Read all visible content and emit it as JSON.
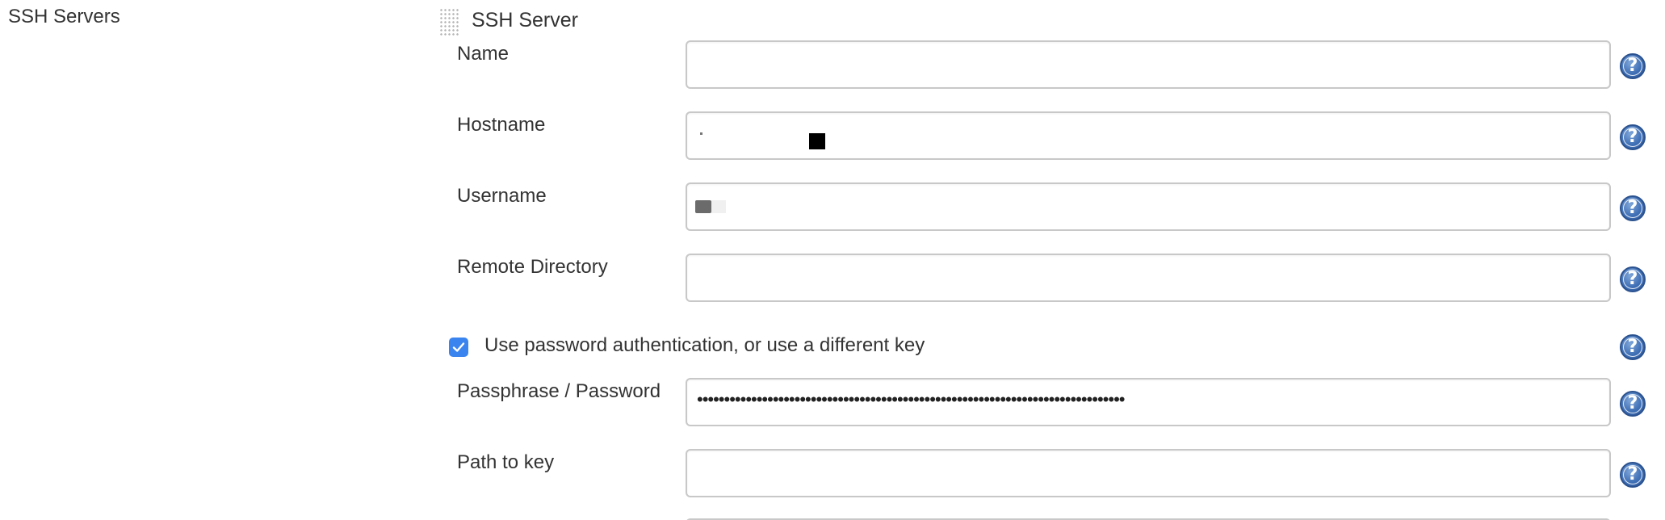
{
  "section": {
    "label": "SSH Servers"
  },
  "server_block": {
    "title": "SSH Server"
  },
  "fields": {
    "name": {
      "label": "Name",
      "value": ""
    },
    "hostname": {
      "label": "Hostname",
      "value": ""
    },
    "username": {
      "label": "Username",
      "value": ""
    },
    "remote_directory": {
      "label": "Remote Directory",
      "value": ""
    },
    "passphrase": {
      "label": "Passphrase / Password",
      "value": "•••••••••••••••••••••••••••••••••••••••••••••••••••••••••••••••••••••••••••••••"
    },
    "path_to_key": {
      "label": "Path to key",
      "value": ""
    }
  },
  "use_password_auth": {
    "label": "Use password authentication, or use a different key",
    "checked": true
  },
  "help": {
    "glyph": "?",
    "icon": "help-icon",
    "color": "#3f6fb5"
  },
  "colors": {
    "checkbox": "#3a84ef",
    "input_border": "#c8c8c8",
    "text": "#333333"
  }
}
